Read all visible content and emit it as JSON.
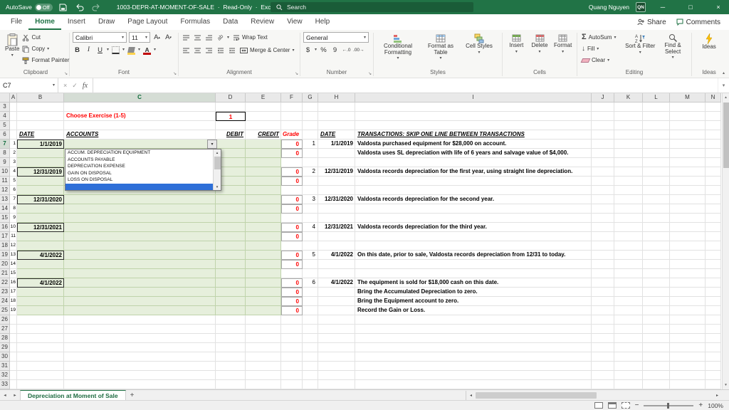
{
  "icons": {
    "minimize": "─",
    "restore": "□",
    "close": "×",
    "cancel": "×",
    "check": "✓",
    "sigma": "Σ",
    "fill_arrow": "↓",
    "increase_decimal": "←.0",
    "decrease_decimal": ".00→"
  },
  "titlebar": {
    "autosave_label": "AutoSave",
    "autosave_state": "Off",
    "doc_title": "1003-DEPR-AT-MOMENT-OF-SALE",
    "doc_mode": "Read-Only",
    "app_name": "Excel",
    "search_placeholder": "Search",
    "user_name": "Quang Nguyen",
    "user_initials": "QN"
  },
  "menubar": {
    "tabs": [
      "File",
      "Home",
      "Insert",
      "Draw",
      "Page Layout",
      "Formulas",
      "Data",
      "Review",
      "View",
      "Help"
    ],
    "active_tab": "Home",
    "share_label": "Share",
    "comments_label": "Comments"
  },
  "ribbon": {
    "clipboard": {
      "group_label": "Clipboard",
      "paste": "Paste",
      "cut": "Cut",
      "copy": "Copy",
      "format_painter": "Format Painter"
    },
    "font": {
      "group_label": "Font",
      "font_name": "Calibri",
      "font_size": "11",
      "bold": "B",
      "italic": "I",
      "underline": "U"
    },
    "alignment": {
      "group_label": "Alignment",
      "wrap_text": "Wrap Text",
      "merge_center": "Merge & Center",
      "orientation": "ab"
    },
    "number": {
      "group_label": "Number",
      "number_format": "General",
      "currency": "$",
      "percent": "%",
      "comma": "9"
    },
    "styles": {
      "group_label": "Styles",
      "conditional_formatting": "Conditional Formatting",
      "format_as_table": "Format as Table",
      "cell_styles": "Cell Styles"
    },
    "cells": {
      "group_label": "Cells",
      "insert": "Insert",
      "delete": "Delete",
      "format": "Format"
    },
    "editing": {
      "group_label": "Editing",
      "autosum": "AutoSum",
      "fill": "Fill",
      "clear": "Clear",
      "sort_filter": "Sort & Filter",
      "find_select": "Find & Select"
    },
    "ideas": {
      "group_label": "Ideas",
      "ideas": "Ideas"
    }
  },
  "formula_bar": {
    "cell_reference": "C7",
    "fx_label": "fx",
    "formula_value": ""
  },
  "grid": {
    "col_headers": [
      "A",
      "B",
      "C",
      "D",
      "E",
      "F",
      "G",
      "H",
      "I",
      "J",
      "K",
      "L",
      "M",
      "N"
    ],
    "row_start": 3,
    "row_end": 33,
    "selected_column": "C",
    "selected_row": 7
  },
  "cells": [
    {
      "c": "C",
      "r": 4,
      "t": "Choose Exercise (1-5)",
      "type": "ex_label"
    },
    {
      "c": "D",
      "r": 4,
      "t": "1",
      "type": "ex_value"
    },
    {
      "c": "B",
      "r": 6,
      "t": "DATE",
      "type": "th"
    },
    {
      "c": "C",
      "r": 6,
      "t": "ACCOUNTS",
      "type": "th"
    },
    {
      "c": "D",
      "r": 6,
      "t": "DEBIT",
      "type": "th th_r"
    },
    {
      "c": "E",
      "r": 6,
      "t": "CREDIT",
      "type": "th th_r"
    },
    {
      "c": "F",
      "r": 6,
      "t": "Grade",
      "type": "grade_h"
    },
    {
      "c": "H",
      "r": 6,
      "t": "DATE",
      "type": "th"
    },
    {
      "c": "I",
      "r": 6,
      "t": "TRANSACTIONS: SKIP ONE LINE BETWEEN TRANSACTIONS",
      "type": "th th_u"
    },
    {
      "c": "A",
      "r": 7,
      "t": "1",
      "type": "sub"
    },
    {
      "c": "A",
      "r": 8,
      "t": "2",
      "type": "sub"
    },
    {
      "c": "A",
      "r": 9,
      "t": "3",
      "type": "sub"
    },
    {
      "c": "A",
      "r": 10,
      "t": "4",
      "type": "sub"
    },
    {
      "c": "A",
      "r": 11,
      "t": "5",
      "type": "sub"
    },
    {
      "c": "A",
      "r": 12,
      "t": "6",
      "type": "sub"
    },
    {
      "c": "A",
      "r": 13,
      "t": "7",
      "type": "sub"
    },
    {
      "c": "A",
      "r": 14,
      "t": "8",
      "type": "sub"
    },
    {
      "c": "A",
      "r": 15,
      "t": "9",
      "type": "sub"
    },
    {
      "c": "A",
      "r": 16,
      "t": "10",
      "type": "sub"
    },
    {
      "c": "A",
      "r": 17,
      "t": "11",
      "type": "sub"
    },
    {
      "c": "A",
      "r": 18,
      "t": "12",
      "type": "sub"
    },
    {
      "c": "A",
      "r": 19,
      "t": "13",
      "type": "sub"
    },
    {
      "c": "A",
      "r": 20,
      "t": "14",
      "type": "sub"
    },
    {
      "c": "A",
      "r": 21,
      "t": "15",
      "type": "sub"
    },
    {
      "c": "A",
      "r": 22,
      "t": "16",
      "type": "sub"
    },
    {
      "c": "A",
      "r": 23,
      "t": "17",
      "type": "sub"
    },
    {
      "c": "A",
      "r": 24,
      "t": "18",
      "type": "sub"
    },
    {
      "c": "A",
      "r": 25,
      "t": "19",
      "type": "sub"
    },
    {
      "c": "B",
      "r": 7,
      "t": "1/1/2019",
      "type": "date"
    },
    {
      "c": "B",
      "r": 10,
      "t": "12/31/2019",
      "type": "date"
    },
    {
      "c": "B",
      "r": 13,
      "t": "12/31/2020",
      "type": "date"
    },
    {
      "c": "B",
      "r": 16,
      "t": "12/31/2021",
      "type": "date"
    },
    {
      "c": "B",
      "r": 19,
      "t": "4/1/2022",
      "type": "date"
    },
    {
      "c": "B",
      "r": 22,
      "t": "4/1/2022",
      "type": "date"
    },
    {
      "c": "F",
      "r": 7,
      "t": "0",
      "type": "grade"
    },
    {
      "c": "F",
      "r": 8,
      "t": "0",
      "type": "grade"
    },
    {
      "c": "F",
      "r": 10,
      "t": "0",
      "type": "grade"
    },
    {
      "c": "F",
      "r": 11,
      "t": "0",
      "type": "grade"
    },
    {
      "c": "F",
      "r": 13,
      "t": "0",
      "type": "grade"
    },
    {
      "c": "F",
      "r": 14,
      "t": "0",
      "type": "grade"
    },
    {
      "c": "F",
      "r": 16,
      "t": "0",
      "type": "grade"
    },
    {
      "c": "F",
      "r": 17,
      "t": "0",
      "type": "grade"
    },
    {
      "c": "F",
      "r": 19,
      "t": "0",
      "type": "grade"
    },
    {
      "c": "F",
      "r": 20,
      "t": "0",
      "type": "grade"
    },
    {
      "c": "F",
      "r": 22,
      "t": "0",
      "type": "grade"
    },
    {
      "c": "F",
      "r": 23,
      "t": "0",
      "type": "grade"
    },
    {
      "c": "F",
      "r": 24,
      "t": "0",
      "type": "grade"
    },
    {
      "c": "F",
      "r": 25,
      "t": "0",
      "type": "grade"
    },
    {
      "c": "G",
      "r": 7,
      "t": "1",
      "type": "gnum"
    },
    {
      "c": "H",
      "r": 7,
      "t": "1/1/2019",
      "type": "hdate"
    },
    {
      "c": "I",
      "r": 7,
      "t": "Valdosta purchased equipment for $28,000 on account.",
      "type": "desc"
    },
    {
      "c": "I",
      "r": 8,
      "t": "Valdosta uses SL depreciation with life of 6 years and salvage value of $4,000.",
      "type": "desc"
    },
    {
      "c": "G",
      "r": 10,
      "t": "2",
      "type": "gnum"
    },
    {
      "c": "H",
      "r": 10,
      "t": "12/31/2019",
      "type": "hdate"
    },
    {
      "c": "I",
      "r": 10,
      "t": "Valdosta records depreciation for the first year, using straight line depreciation.",
      "type": "desc"
    },
    {
      "c": "G",
      "r": 13,
      "t": "3",
      "type": "gnum"
    },
    {
      "c": "H",
      "r": 13,
      "t": "12/31/2020",
      "type": "hdate"
    },
    {
      "c": "I",
      "r": 13,
      "t": "Valdosta records depreciation for the second year.",
      "type": "desc"
    },
    {
      "c": "G",
      "r": 16,
      "t": "4",
      "type": "gnum"
    },
    {
      "c": "H",
      "r": 16,
      "t": "12/31/2021",
      "type": "hdate"
    },
    {
      "c": "I",
      "r": 16,
      "t": "Valdosta records depreciation for the third year.",
      "type": "desc"
    },
    {
      "c": "G",
      "r": 19,
      "t": "5",
      "type": "gnum"
    },
    {
      "c": "H",
      "r": 19,
      "t": "4/1/2022",
      "type": "hdate"
    },
    {
      "c": "I",
      "r": 19,
      "t": "On this date, prior to sale, Valdosta records depreciation from 12/31 to today.",
      "type": "desc"
    },
    {
      "c": "G",
      "r": 22,
      "t": "6",
      "type": "gnum"
    },
    {
      "c": "H",
      "r": 22,
      "t": "4/1/2022",
      "type": "hdate"
    },
    {
      "c": "I",
      "r": 22,
      "t": "The equipment is sold for $18,000 cash on this date.",
      "type": "desc"
    },
    {
      "c": "I",
      "r": 23,
      "t": "Bring the Accumulated Depreciation to zero.",
      "type": "desc"
    },
    {
      "c": "I",
      "r": 24,
      "t": "Bring the Equipment account to zero.",
      "type": "desc"
    },
    {
      "c": "I",
      "r": 25,
      "t": "Record the Gain or Loss.",
      "type": "desc"
    }
  ],
  "dropdown": {
    "items": [
      "ACCUM. DEPRECIATION EQUIPMENT",
      "ACCOUNTS PAYABLE",
      "DEPRECIATION EXPENSE",
      "GAIN ON DISPOSAL",
      "LOSS ON DISPOSAL"
    ],
    "has_selected_blank_row": true
  },
  "sheet_tabs": {
    "active_sheet": "Depreciation at Moment of Sale"
  },
  "status_bar": {
    "zoom_level": "100%"
  }
}
